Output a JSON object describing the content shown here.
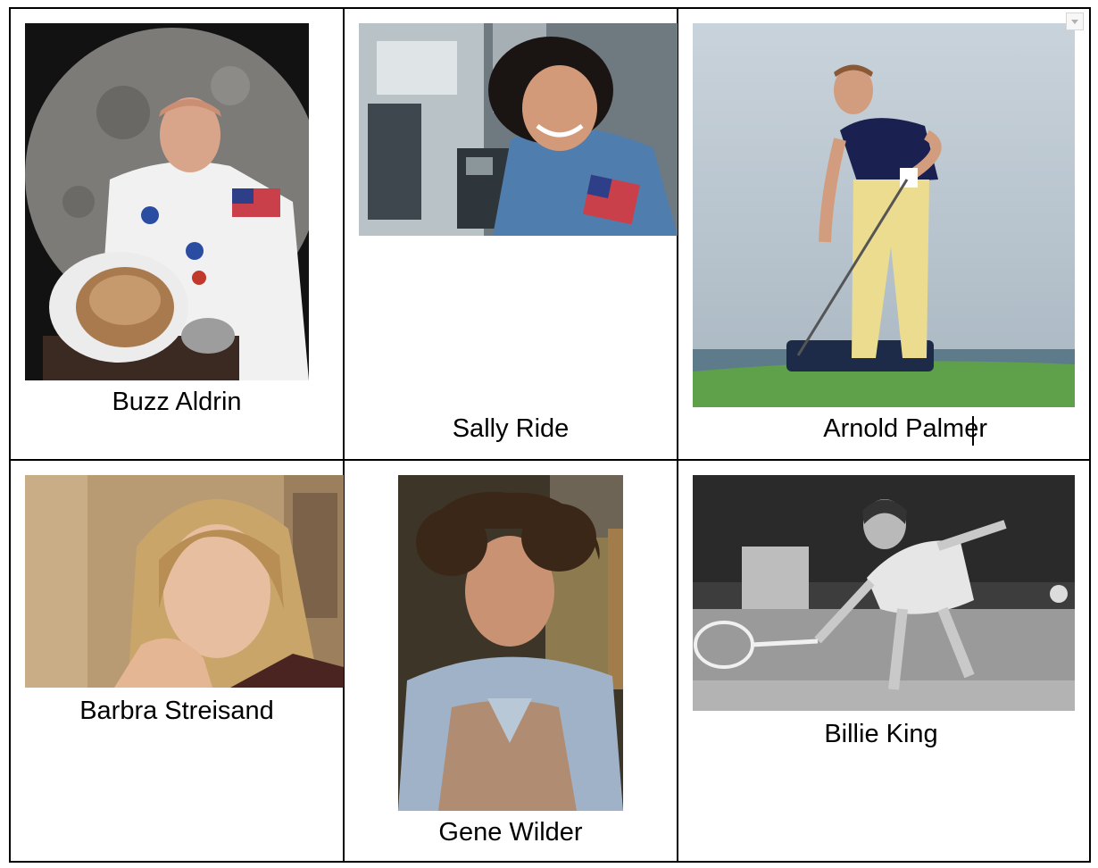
{
  "table": {
    "cells": [
      {
        "caption": "Buzz Aldrin",
        "photo_alt": "astronaut-photo"
      },
      {
        "caption": "Sally Ride",
        "photo_alt": "astronaut-photo"
      },
      {
        "caption": "Arnold Palmer",
        "photo_alt": "golfer-photo"
      },
      {
        "caption": "Barbra Streisand",
        "photo_alt": "portrait-photo"
      },
      {
        "caption": "Gene Wilder",
        "photo_alt": "portrait-photo"
      },
      {
        "caption": "Billie King",
        "photo_alt": "tennis-photo"
      }
    ]
  },
  "colors": {
    "border": "#000000",
    "text": "#000000",
    "page": "#ffffff"
  },
  "icons": {
    "cell_menu": "chevron-down-icon"
  }
}
